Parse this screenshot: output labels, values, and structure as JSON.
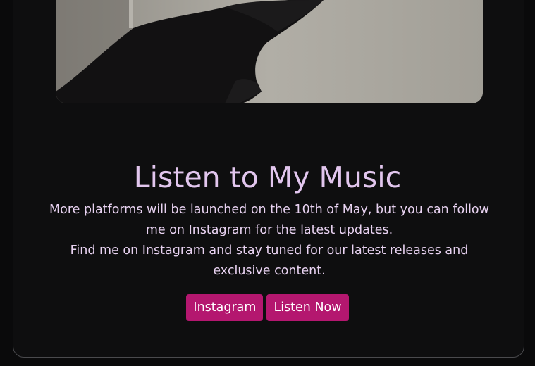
{
  "music_section": {
    "title": "Listen to My Music",
    "description_line1": "More platforms will be launched on the 10th of May, but you can follow me on Instagram for the latest updates.",
    "description_line2": "Find me on Instagram and stay tuned for our latest releases and exclusive content.",
    "buttons": {
      "instagram_label": "Instagram",
      "listen_label": "Listen Now"
    }
  },
  "colors": {
    "background": "#0a0a0b",
    "title": "#e2c6ee",
    "text": "#e8d2f1",
    "button": "#b4176f"
  }
}
